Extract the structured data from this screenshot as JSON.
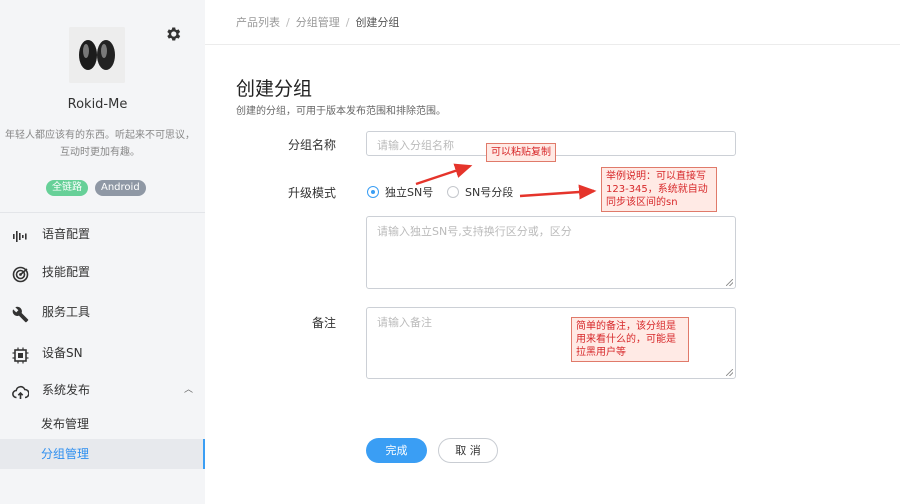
{
  "sidebar": {
    "app_name": "Rokid-Me",
    "app_desc": "年轻人都应该有的东西。听起来不可思议，互动时更加有趣。",
    "tags": [
      "全链路",
      "Android"
    ],
    "nav": [
      {
        "label": "语音配置",
        "icon": "audio-wave-icon"
      },
      {
        "label": "技能配置",
        "icon": "target-icon"
      },
      {
        "label": "服务工具",
        "icon": "wrench-icon"
      },
      {
        "label": "设备SN",
        "icon": "chip-icon"
      },
      {
        "label": "系统发布",
        "icon": "cloud-upload-icon",
        "expanded": true
      }
    ],
    "sub": [
      {
        "label": "发布管理",
        "active": false
      },
      {
        "label": "分组管理",
        "active": true
      }
    ]
  },
  "breadcrumb": [
    "产品列表",
    "分组管理",
    "创建分组"
  ],
  "page": {
    "title": "创建分组",
    "subtitle": "创建的分组，可用于版本发布范围和排除范围。"
  },
  "form": {
    "name_label": "分组名称",
    "name_placeholder": "请输入分组名称",
    "mode_label": "升级模式",
    "mode_options": [
      "独立SN号",
      "SN号分段"
    ],
    "mode_selected": "独立SN号",
    "sn_placeholder": "请输入独立SN号,支持换行区分或，区分",
    "remark_label": "备注",
    "remark_placeholder": "请输入备注"
  },
  "annotations": {
    "paste": "可以粘贴复制",
    "example": "举例说明：可以直接写123-345，系统就自动同步该区间的sn",
    "remark": "简单的备注，该分组是用来看什么的，可能是拉黑用户等"
  },
  "buttons": {
    "submit": "完成",
    "cancel": "取 消"
  },
  "colors": {
    "primary": "#3a9ef4",
    "annotation_red": "#d7282a",
    "sidebar_bg": "#f4f5f7"
  }
}
